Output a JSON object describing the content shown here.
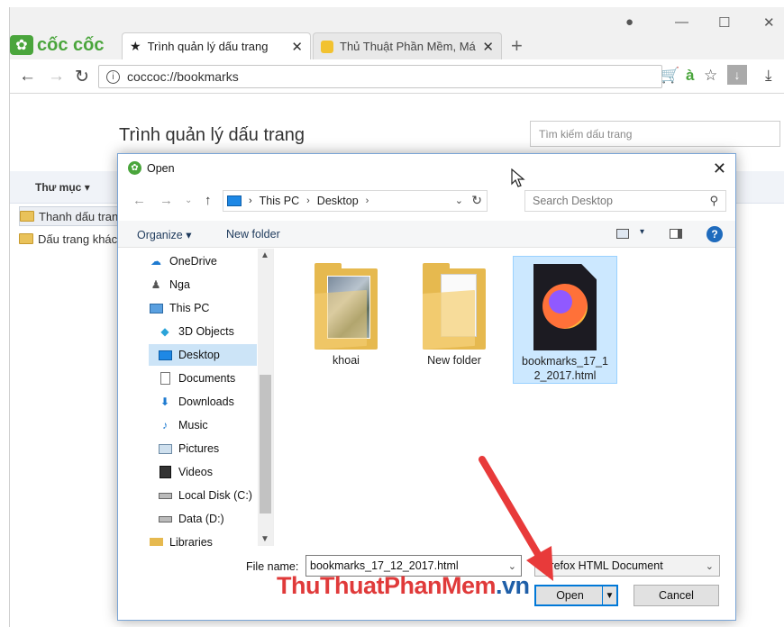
{
  "browser": {
    "logo_text": "cốc cốc",
    "tabs": [
      {
        "label": "Trình quản lý dấu trang",
        "icon": "star-icon",
        "active": true
      },
      {
        "label": "Thủ Thuật Phần Mềm, Má",
        "icon": "bulb-icon",
        "active": false
      }
    ],
    "new_tab_glyph": "+",
    "address": "coccoc://bookmarks",
    "accent": "#4aa53c"
  },
  "bookmarks_page": {
    "title": "Trình quản lý dấu trang",
    "search_placeholder": "Tìm kiếm dấu trang",
    "folders_label": "Thư mục",
    "folders": [
      "Thanh dấu trang",
      "Dấu trang khác"
    ]
  },
  "dialog": {
    "title": "Open",
    "path": [
      "This PC",
      "Desktop"
    ],
    "search_placeholder": "Search Desktop",
    "organize": "Organize",
    "new_folder": "New folder",
    "nav_items": [
      {
        "label": "OneDrive",
        "icon": "cloud-icon"
      },
      {
        "label": "Nga",
        "icon": "user-icon"
      },
      {
        "label": "This PC",
        "icon": "computer-icon"
      },
      {
        "label": "3D Objects",
        "icon": "cube-icon"
      },
      {
        "label": "Desktop",
        "icon": "desktop-icon",
        "selected": true
      },
      {
        "label": "Documents",
        "icon": "document-icon"
      },
      {
        "label": "Downloads",
        "icon": "download-icon"
      },
      {
        "label": "Music",
        "icon": "music-icon"
      },
      {
        "label": "Pictures",
        "icon": "picture-icon"
      },
      {
        "label": "Videos",
        "icon": "video-icon"
      },
      {
        "label": "Local Disk (C:)",
        "icon": "drive-icon"
      },
      {
        "label": "Data (D:)",
        "icon": "drive-icon"
      },
      {
        "label": "Libraries",
        "icon": "library-icon"
      }
    ],
    "files": [
      {
        "name": "khoai",
        "kind": "photo-folder"
      },
      {
        "name": "New folder",
        "kind": "doc-folder"
      },
      {
        "name_line1": "bookmarks_17_1",
        "name_line2": "2_2017.html",
        "kind": "firefox-html",
        "selected": true
      }
    ],
    "file_name_label": "File name:",
    "file_name_value": "bookmarks_17_12_2017.html",
    "file_type": "Firefox HTML Document",
    "open_label": "Open",
    "cancel_label": "Cancel"
  },
  "watermark": {
    "part1": "ThuThuat",
    "part2": "PhanMem",
    "part3": ".vn",
    "color1": "#e03a3a",
    "color2": "#e03a3a",
    "color3": "#1f5fa8"
  }
}
